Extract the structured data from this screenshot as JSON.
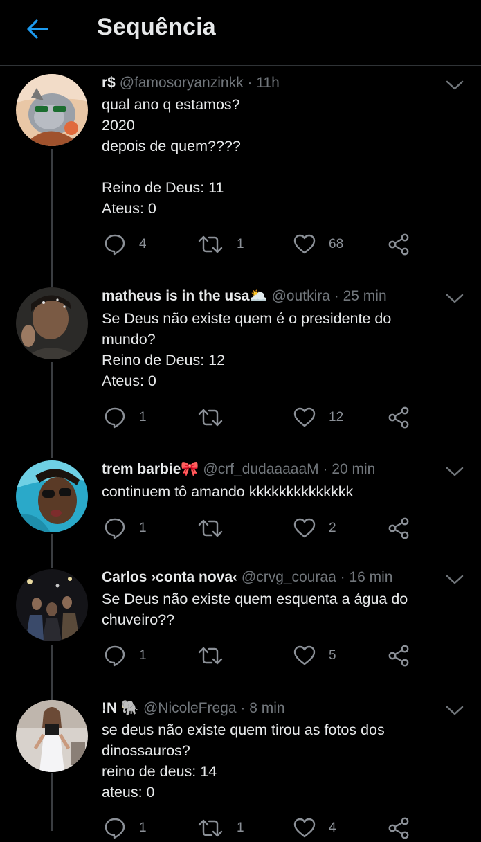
{
  "header": {
    "title": "Sequência",
    "back_icon": "arrow-left-icon",
    "accent_color": "#1d9bf0"
  },
  "tweets": [
    {
      "name": "r$",
      "handle": "@famosoryanzinkk",
      "time": "11h",
      "text": "qual ano q estamos?\n2020\ndepois de quem????\n\nReino de Deus: 11\nAteus: 0",
      "replies": "4",
      "retweets": "1",
      "likes": "68"
    },
    {
      "name": "matheus is in the usa🌥️",
      "handle": "@outkira",
      "time": "25 min",
      "text": "Se Deus não existe quem é o presidente do\nmundo?\nReino de Deus: 12\nAteus: 0",
      "replies": "1",
      "retweets": "",
      "likes": "12"
    },
    {
      "name": "trem barbie🎀",
      "handle": "@crf_dudaaaaaM",
      "time": "20 min",
      "text": "continuem tô amando kkkkkkkkkkkkkk",
      "replies": "1",
      "retweets": "",
      "likes": "2"
    },
    {
      "name": "Carlos ›conta nova‹",
      "handle": "@crvg_couraa",
      "time": "16 min",
      "text": "Se Deus não existe quem esquenta a água do\nchuveiro??",
      "replies": "1",
      "retweets": "",
      "likes": "5"
    },
    {
      "name": "!N 🐘",
      "handle": "@NicoleFrega",
      "time": "8 min",
      "text": "se deus não existe quem tirou as fotos dos\ndinossauros?\nreino de deus: 14\nateus: 0",
      "replies": "1",
      "retweets": "1",
      "likes": "4"
    }
  ],
  "icons": {
    "reply": "reply-icon",
    "retweet": "retweet-icon",
    "like": "heart-icon",
    "share": "share-icon",
    "more": "chevron-down-icon"
  },
  "colors": {
    "background": "#000000",
    "text": "#e7e9ea",
    "secondary": "#71767b",
    "action": "#8b9097",
    "thread_line": "#3a3d41"
  }
}
